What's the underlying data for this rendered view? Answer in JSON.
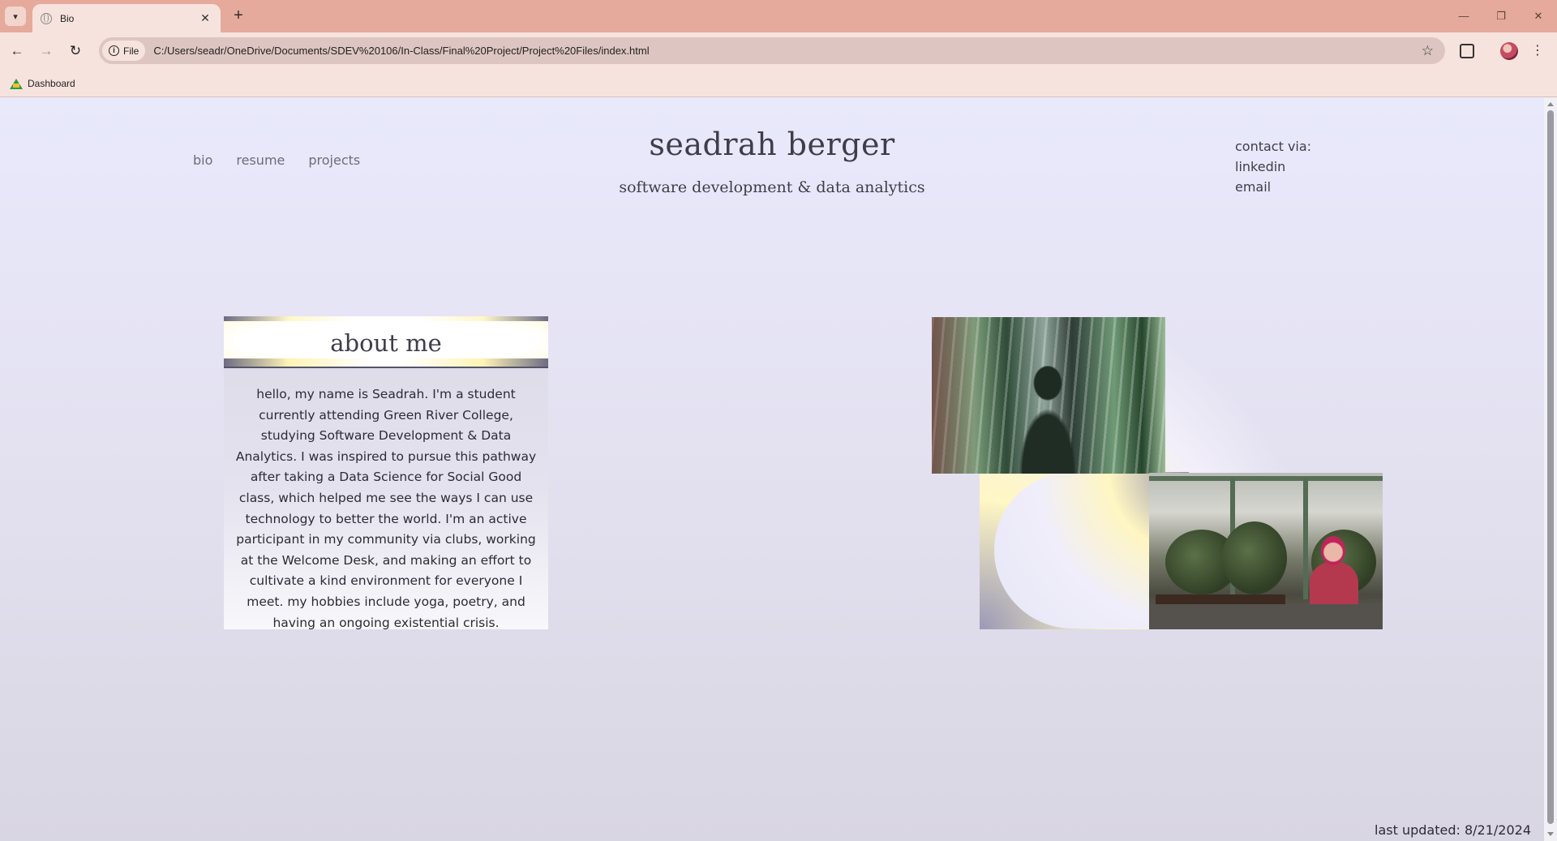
{
  "browser": {
    "tab_title": "Bio",
    "tab_close": "✕",
    "new_tab": "+",
    "url_chip": "File",
    "url": "C:/Users/seadr/OneDrive/Documents/SDEV%20106/In-Class/Final%20Project/Project%20Files/index.html",
    "bookmarks": [
      {
        "label": "Dashboard"
      }
    ],
    "window_controls": {
      "minimize": "—",
      "restore": "❐",
      "close": "✕"
    }
  },
  "site": {
    "nav": [
      "bio",
      "resume",
      "projects"
    ],
    "title": "seadrah berger",
    "subtitle": "software development & data analytics",
    "contact": {
      "heading": "contact via:",
      "links": [
        "linkedin",
        "email"
      ]
    }
  },
  "about": {
    "title": "about me",
    "text": "hello, my name is Seadrah. I'm a student currently attending Green River College, studying Software Development & Data Analytics. I was inspired to pursue this pathway after taking a Data Science for Social Good class, which helped me see the ways I can use technology to better the world. I'm an active participant in my community via clubs, working at the Welcome Desk, and making an effort to cultivate a kind environment for everyone I meet. my hobbies include yoga, poetry, and having an ongoing existential crisis."
  },
  "footer": {
    "last_updated": "last updated: 8/21/2024"
  },
  "icons": {
    "tab_menu": "chevron-down-icon",
    "favicon": "globe-icon",
    "back": "arrow-left-icon",
    "forward": "arrow-right-icon",
    "reload": "reload-icon",
    "info": "info-icon",
    "bookmark_star": "star-icon",
    "extensions": "puzzle-icon",
    "menu": "kebab-menu-icon",
    "bookmark_favicon": "drive-icon"
  },
  "colors": {
    "tabstrip": "#e5aa9b",
    "toolbar": "#f7e3de",
    "omnibox": "#ddc6c1",
    "page_background": "#e9e9fc",
    "text": "#3e3d4a"
  }
}
